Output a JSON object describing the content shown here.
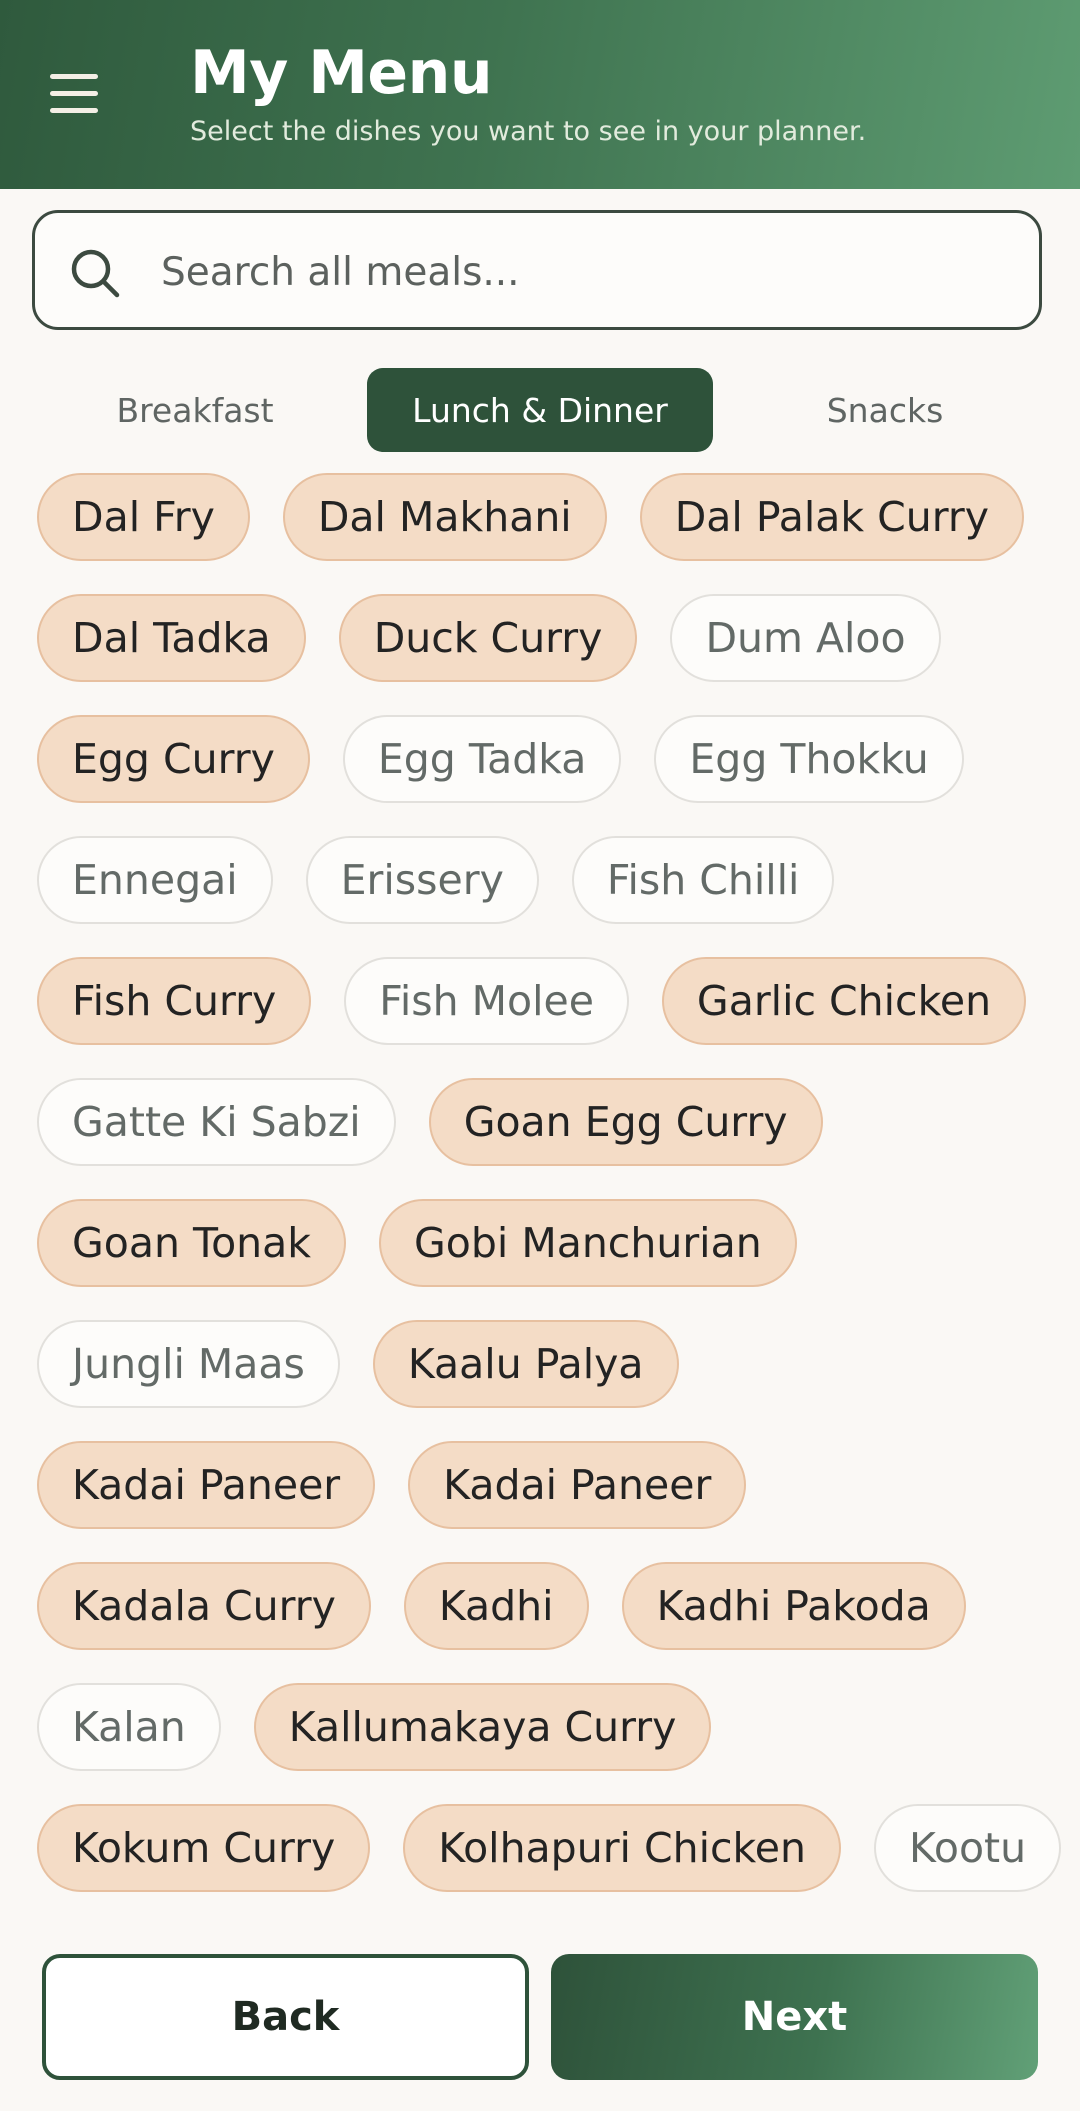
{
  "header": {
    "title": "My Menu",
    "subtitle": "Select the dishes you want to see in your planner.",
    "menu_icon": "hamburger-menu-icon"
  },
  "search": {
    "placeholder": "Search all meals...",
    "value": "",
    "icon": "search-icon"
  },
  "tabs": [
    {
      "label": "Breakfast",
      "active": false
    },
    {
      "label": "Lunch & Dinner",
      "active": true
    },
    {
      "label": "Snacks",
      "active": false
    }
  ],
  "dishes": [
    [
      {
        "label": "Dal Fry",
        "selected": true
      },
      {
        "label": "Dal Makhani",
        "selected": true
      },
      {
        "label": "Dal Palak Curry",
        "selected": true
      }
    ],
    [
      {
        "label": "Dal Tadka",
        "selected": true
      },
      {
        "label": "Duck Curry",
        "selected": true
      },
      {
        "label": "Dum Aloo",
        "selected": false
      }
    ],
    [
      {
        "label": "Egg Curry",
        "selected": true
      },
      {
        "label": "Egg Tadka",
        "selected": false
      },
      {
        "label": "Egg Thokku",
        "selected": false
      }
    ],
    [
      {
        "label": "Ennegai",
        "selected": false
      },
      {
        "label": "Erissery",
        "selected": false
      },
      {
        "label": "Fish Chilli",
        "selected": false
      }
    ],
    [
      {
        "label": "Fish Curry",
        "selected": true
      },
      {
        "label": "Fish Molee",
        "selected": false
      },
      {
        "label": "Garlic Chicken",
        "selected": true
      }
    ],
    [
      {
        "label": "Gatte Ki Sabzi",
        "selected": false
      },
      {
        "label": "Goan Egg Curry",
        "selected": true
      }
    ],
    [
      {
        "label": "Goan Tonak",
        "selected": true
      },
      {
        "label": "Gobi Manchurian",
        "selected": true
      }
    ],
    [
      {
        "label": "Jungli Maas",
        "selected": false
      },
      {
        "label": "Kaalu Palya",
        "selected": true
      }
    ],
    [
      {
        "label": "Kadai Paneer",
        "selected": true
      },
      {
        "label": "Kadai Paneer",
        "selected": true
      }
    ],
    [
      {
        "label": "Kadala Curry",
        "selected": true
      },
      {
        "label": "Kadhi",
        "selected": true
      },
      {
        "label": "Kadhi Pakoda",
        "selected": true
      }
    ],
    [
      {
        "label": "Kalan",
        "selected": false
      },
      {
        "label": "Kallumakaya Curry",
        "selected": true
      }
    ],
    [
      {
        "label": "Kokum Curry",
        "selected": true
      },
      {
        "label": "Kolhapuri Chicken",
        "selected": true
      },
      {
        "label": "Kootu",
        "selected": false
      }
    ]
  ],
  "footer": {
    "back_label": "Back",
    "next_label": "Next"
  },
  "colors": {
    "primary": "#2E523A",
    "chip_selected_bg": "#F4DCC6",
    "chip_selected_border": "#E7C0A0",
    "background": "#FAF8F5"
  }
}
